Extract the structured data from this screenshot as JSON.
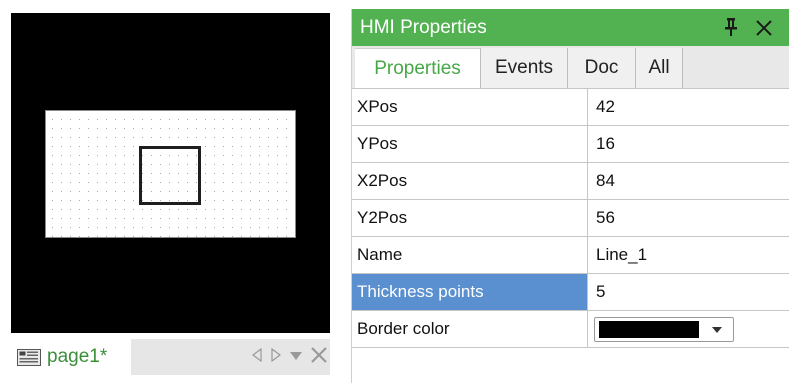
{
  "canvas": {
    "page_tab_label": "page1*"
  },
  "panel": {
    "title": "HMI Properties",
    "tabs": [
      {
        "label": "Properties",
        "active": true
      },
      {
        "label": "Events",
        "active": false
      },
      {
        "label": "Doc",
        "active": false
      },
      {
        "label": "All",
        "active": false
      }
    ],
    "rows": [
      {
        "key": "XPos",
        "value": "42"
      },
      {
        "key": "YPos",
        "value": "16"
      },
      {
        "key": "X2Pos",
        "value": "84"
      },
      {
        "key": "Y2Pos",
        "value": "56"
      },
      {
        "key": "Name",
        "value": "Line_1"
      },
      {
        "key": "Thickness points",
        "value": "5",
        "selected": true
      },
      {
        "key": "Border color",
        "value": ""
      }
    ],
    "border_color_value": "#000000"
  },
  "colors": {
    "header_bg": "#52b251",
    "active_tab_text": "#47a847",
    "selected_row_bg": "#5a8fd0",
    "canvas_bg": "#000000"
  },
  "icons": {
    "page_icon": "page-icon",
    "nav_prev": "triangle-left-icon",
    "nav_next": "triangle-right-icon",
    "nav_menu": "chevron-down-icon",
    "nav_close": "close-icon",
    "pin": "pin-icon",
    "close": "close-icon"
  }
}
